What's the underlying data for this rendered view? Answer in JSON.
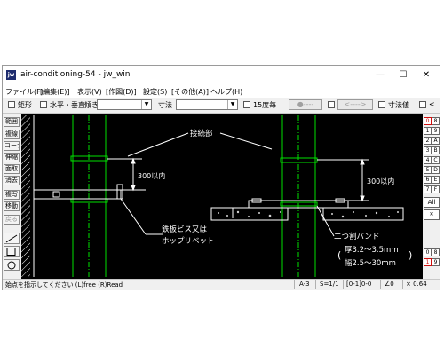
{
  "window": {
    "title": "air-conditioning-54 - jw_win",
    "icon_text": "jw",
    "minimize": "—",
    "maximize": "☐",
    "close": "✕"
  },
  "menu": [
    "ファイル(F)",
    "[編集(E)]",
    "表示(V)",
    "[作図(D)]",
    "設定(S)",
    "[その他(A)]",
    "ヘルプ(H)"
  ],
  "toolbar": {
    "rect": "矩形",
    "hv": "水平・垂直",
    "tilt": "傾き",
    "dim": "寸法",
    "deg15": "15度毎",
    "btn1": "●----",
    "btn2": "<---->",
    "dimval": "寸法値",
    "lt": "<"
  },
  "left_tools": [
    "範囲",
    "複線",
    "コーナー",
    "伸縮",
    "面取",
    "消去",
    "複写",
    "移動",
    "戻る"
  ],
  "right_tools": {
    "layers_left": [
      "0",
      "1",
      "2",
      "3",
      "4",
      "5",
      "6",
      "7"
    ],
    "layers_right": [
      "8",
      "9",
      "A",
      "B",
      "C",
      "D",
      "E",
      "F"
    ],
    "all": "All",
    "group_left": [
      "0",
      "1"
    ],
    "group_right": [
      "8",
      "9"
    ]
  },
  "drawing": {
    "label_joint": "接続部",
    "label_300a": "300以内",
    "label_300b": "300以内",
    "label_screw1": "鉄板ビス又は",
    "label_screw2": "ホップリベット",
    "label_band1": "二つ割バンド",
    "label_band2": "厚3.2～3.5mm",
    "label_band3": "幅2.5～30mm",
    "paren_open": "(",
    "paren_close": ")",
    "colors": {
      "pipe": "#00e000",
      "dim": "#ffffff",
      "hatch": "#d0d0d0"
    }
  },
  "status": {
    "prompt": "始点を指示してください (L)free (R)Read",
    "paper": "A-3",
    "scale": "S=1/1",
    "layer": "[0-1]0-0",
    "angle": "∠0",
    "zoom": "× 0.64"
  }
}
